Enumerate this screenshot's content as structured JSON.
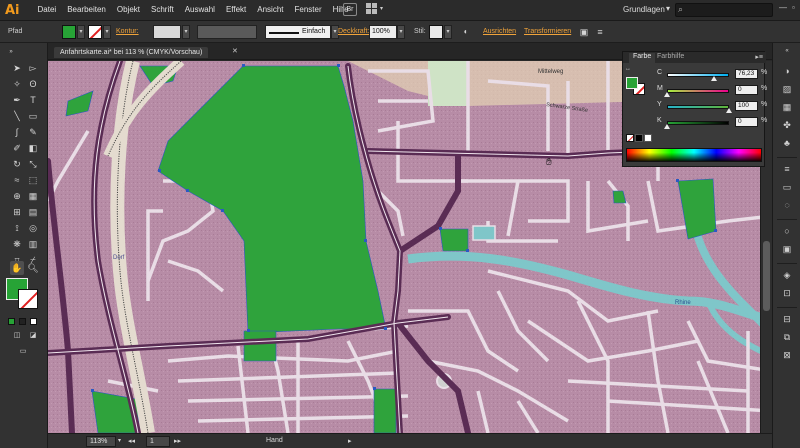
{
  "app": {
    "logo": "Ai"
  },
  "menu": [
    "Datei",
    "Bearbeiten",
    "Objekt",
    "Schrift",
    "Auswahl",
    "Effekt",
    "Ansicht",
    "Fenster",
    "Hilfe"
  ],
  "menubar": {
    "bridge_label": "Br",
    "workspace": "Grundlagen",
    "workspace_arrow": "▾",
    "search_icon": "search-icon",
    "window_controls": [
      "—",
      "▫",
      "✕"
    ]
  },
  "controlbar": {
    "selection_label": "Pfad",
    "fill_color": "#27a336",
    "stroke_label": "Kontur:",
    "stroke_style_label": "Einfach",
    "opacity_label": "Deckkraft:",
    "opacity_value": "100%",
    "style_label": "Stil:",
    "align_label": "Ausrichten",
    "transform_label": "Transformieren",
    "accent_color": "#f0a33a"
  },
  "document": {
    "tab_title": "Anfahrtskarte.ai* bei 113 % (CMYK/Vorschau)",
    "close_icon": "✕"
  },
  "map": {
    "labels": [
      "Mittelweg",
      "Schwarze Straße",
      "Dorf"
    ],
    "river_label": "Rhine",
    "background": "#b58aa3",
    "road_color": "#e8dde4",
    "main_road_color": "#5b2d55",
    "green_color": "#2fa33c",
    "water_color": "#7fc6c9"
  },
  "color_panel": {
    "tabs": [
      "Farbe",
      "Farbhilfe"
    ],
    "menu_icon": "▸≡",
    "channels": [
      {
        "label": "C",
        "value": "76,23",
        "unit": "%",
        "level": 76.23,
        "gradient": "linear-gradient(to right,#ffffff,#00aeef)"
      },
      {
        "label": "M",
        "value": "0",
        "unit": "%",
        "level": 0,
        "gradient": "linear-gradient(to right,#a4f03e,#ec008c)"
      },
      {
        "label": "Y",
        "value": "100",
        "unit": "%",
        "level": 100,
        "gradient": "linear-gradient(to right,#27b2c9,#5fb33a)"
      },
      {
        "label": "K",
        "value": "0",
        "unit": "%",
        "level": 0,
        "gradient": "linear-gradient(to right,#27a336,#000000)"
      }
    ]
  },
  "statusbar": {
    "zoom": "113%",
    "artboard": "1",
    "tool_name": "Hand"
  }
}
